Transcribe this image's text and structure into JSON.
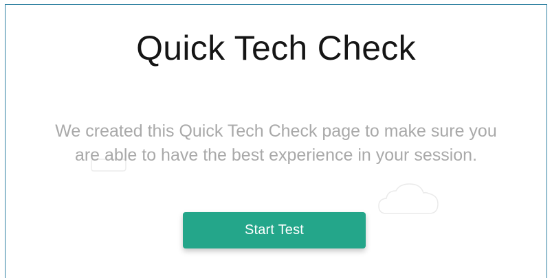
{
  "page": {
    "title": "Quick Tech Check",
    "description_line_1": "We created this Quick Tech Check page to make sure you",
    "description_line_2": "are able to have the best experience in your session."
  },
  "actions": {
    "start_label": "Start Test"
  },
  "colors": {
    "frame_border": "#2c7fa0",
    "title_text": "#151515",
    "description_text": "#a9a9a9",
    "button_background": "#24a68a",
    "button_text": "#ffffff"
  },
  "icons": {
    "background_left": "cloud-icon",
    "background_right": "cloud-icon"
  }
}
